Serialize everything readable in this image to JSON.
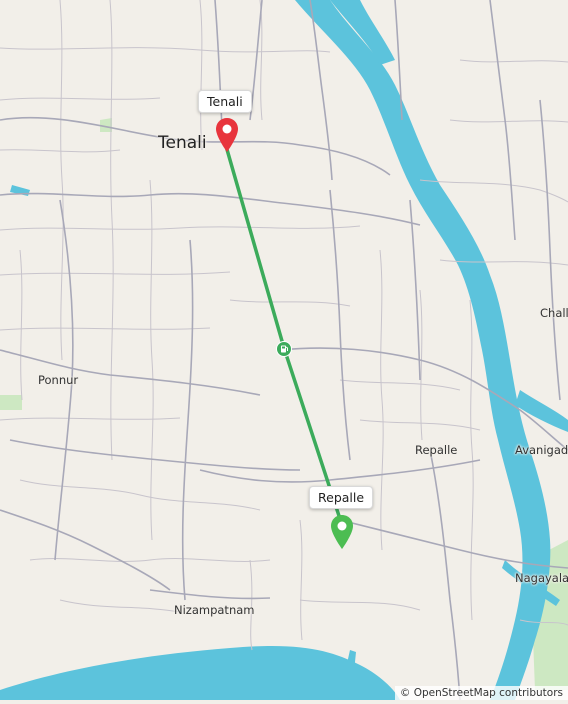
{
  "map": {
    "places": {
      "tenali": "Tenali",
      "ponnur": "Ponnur",
      "repalle": "Repalle",
      "nizampatnam": "Nizampatnam",
      "avanigadda": "Avanigad",
      "challapalli": "Chall",
      "nagayalanka": "Nagayala"
    },
    "route": {
      "start_label": "Tenali",
      "end_label": "Repalle",
      "midpoint_icon": "fuel-station-icon",
      "line_color": "#3cab5b"
    },
    "markers": {
      "start_color": "#e8343c",
      "end_color": "#4cbd52"
    },
    "attribution": "© OpenStreetMap contributors",
    "colors": {
      "land": "#f2efe9",
      "water": "#5cc3dc",
      "roads": "#a8a8b8"
    }
  }
}
